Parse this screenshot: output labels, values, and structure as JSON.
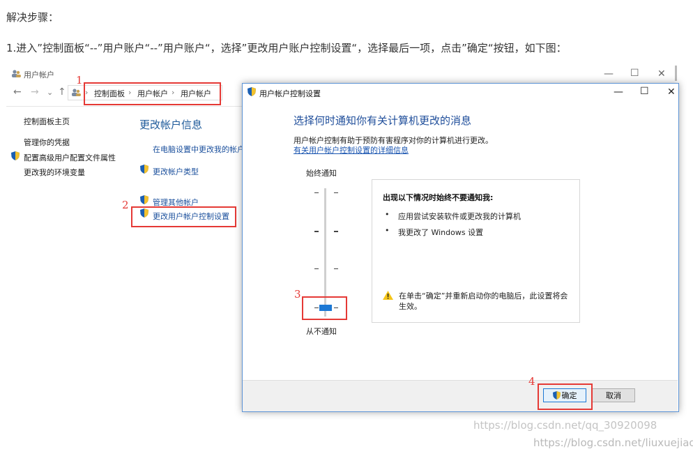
{
  "intro": {
    "heading": "解决步骤：",
    "instruction": "1.进入”控制面板“--”用户账户“--”用户账户“，选择”更改用户账户控制设置“，选择最后一项，点击”确定“按钮，如下图："
  },
  "bg_window": {
    "title": "用户帐户",
    "controls": {
      "minimize": "—",
      "maximize": "☐",
      "close": "✕"
    },
    "nav": {
      "back": "←",
      "forward": "→",
      "recent": "⌄",
      "up": "↑"
    },
    "breadcrumb": [
      "控制面板",
      "用户帐户",
      "用户帐户"
    ],
    "breadcrumb_sep": "›",
    "sidebar": {
      "items": [
        "控制面板主页",
        "管理你的凭据",
        "配置高级用户配置文件属性",
        "更改我的环境变量"
      ]
    },
    "main": {
      "heading": "更改帐户信息",
      "links": [
        "在电脑设置中更改我的帐户信",
        "更改帐户类型",
        "管理其他帐户",
        "更改用户帐户控制设置"
      ]
    }
  },
  "dialog": {
    "title": "用户帐户控制设置",
    "controls": {
      "minimize": "—",
      "maximize": "☐",
      "close": "✕"
    },
    "heading": "选择何时通知你有关计算机更改的消息",
    "description": "用户帐户控制有助于预防有害程序对你的计算机进行更改。",
    "help_link": "有关用户帐户控制设置的详细信息",
    "slider": {
      "top_label": "始终通知",
      "bottom_label": "从不通知",
      "levels": 4,
      "selected_level": 1
    },
    "info": {
      "heading": "出现以下情况时始终不要通知我:",
      "bullets": [
        "应用尝试安装软件或更改我的计算机",
        "我更改了 Windows 设置"
      ],
      "warning": "在单击“确定”并重新启动你的电脑后，此设置将会生效。"
    },
    "buttons": {
      "ok": "确定",
      "cancel": "取消"
    }
  },
  "annotations": {
    "n1": "1",
    "n2": "2",
    "n3": "3",
    "n4": "4"
  },
  "watermarks": {
    "line1": "https://blog.csdn.net/qq_30920098",
    "line2": "https://blog.csdn.net/liuxuejiao_"
  },
  "colors": {
    "annotation_red": "#e53935",
    "slider_blue": "#1c78d4",
    "link_blue": "#1a55b0"
  }
}
